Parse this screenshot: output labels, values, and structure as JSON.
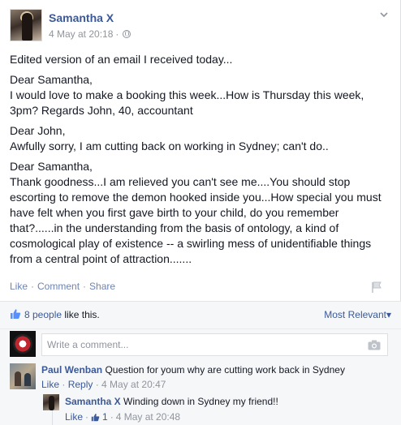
{
  "post": {
    "author": "Samantha X",
    "timestamp": "4 May at 20:18",
    "separator": "·",
    "privacy_icon": "globe-icon",
    "paragraphs": [
      [
        "Edited version of an email I received today..."
      ],
      [
        "Dear Samantha,",
        "I would love to make a booking this week...How is Thursday this week,",
        "3pm? Regards John, 40, accountant"
      ],
      [
        "Dear John,",
        "Awfully sorry, I am cutting back on working in Sydney; can't do.."
      ],
      [
        "Dear Samantha,",
        "Thank goodness...I am relieved you can't see me....You should stop",
        "escorting to remove the demon hooked inside you...How special you must",
        "have felt when you first gave birth to your child, do you remember",
        "that?......in the understanding from the basis of ontology, a kind of",
        "cosmological play of existence -- a swirling mess of unidentifiable things",
        "from a central point of attraction......."
      ]
    ]
  },
  "actions": {
    "like": "Like",
    "comment": "Comment",
    "share": "Share",
    "dot": "·"
  },
  "likes": {
    "count_text": "8 people",
    "suffix": "like this.",
    "sort_label": "Most Relevant",
    "sort_caret": "▾"
  },
  "composer": {
    "placeholder": "Write a comment..."
  },
  "comments": [
    {
      "author": "Paul Wenban",
      "text": "Question for youm why are cutting work back in Sydney",
      "like": "Like",
      "reply": "Reply",
      "timestamp": "4 May at 20:47"
    },
    {
      "author": "Samantha X",
      "text": "Winding down in Sydney my friend!!",
      "like": "Like",
      "like_count": "1",
      "timestamp": "4 May at 20:48"
    }
  ],
  "colors": {
    "link": "#3b5998",
    "muted": "#90949c",
    "text": "#141823",
    "bar": "#f6f7f9"
  }
}
